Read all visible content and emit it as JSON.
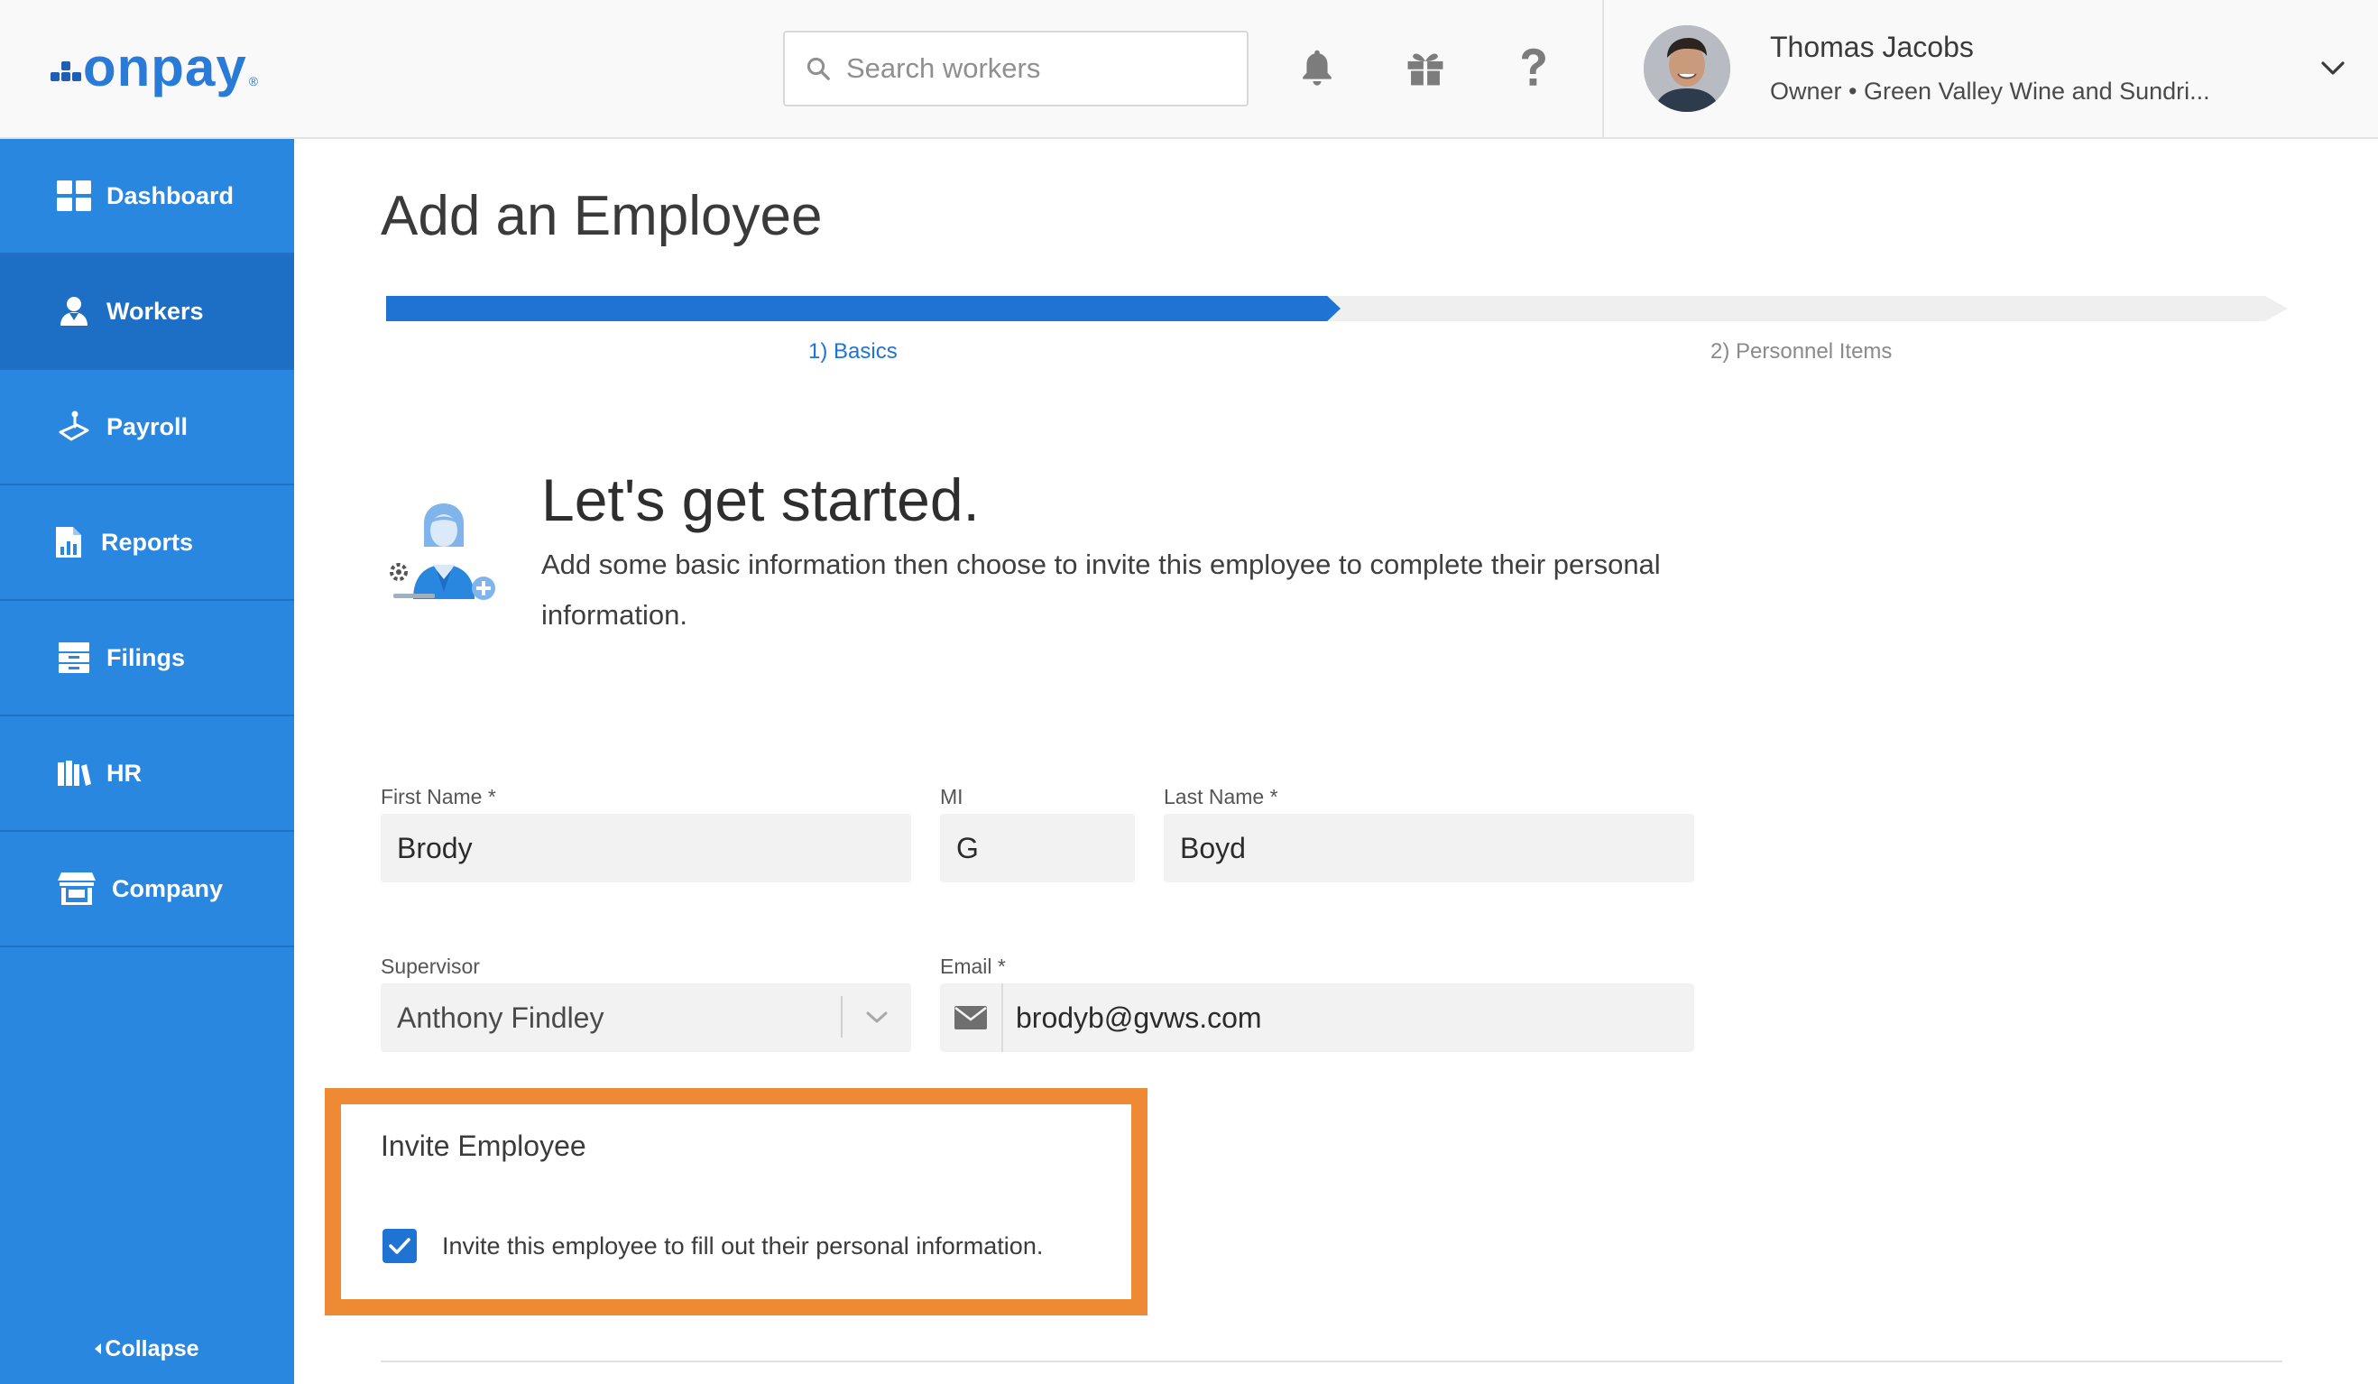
{
  "app": {
    "logo_text": "onpay",
    "logo_mark": "®"
  },
  "header": {
    "search_placeholder": "Search workers",
    "icons": [
      "bell-icon",
      "gift-icon",
      "help-icon"
    ],
    "user": {
      "name": "Thomas Jacobs",
      "role": "Owner • Green Valley Wine and Sundri..."
    }
  },
  "sidebar": {
    "items": [
      {
        "label": "Dashboard",
        "icon": "dashboard-icon",
        "active": false
      },
      {
        "label": "Workers",
        "icon": "workers-icon",
        "active": true
      },
      {
        "label": "Payroll",
        "icon": "payroll-icon",
        "active": false
      },
      {
        "label": "Reports",
        "icon": "reports-icon",
        "active": false
      },
      {
        "label": "Filings",
        "icon": "filings-icon",
        "active": false
      },
      {
        "label": "HR",
        "icon": "hr-icon",
        "active": false
      },
      {
        "label": "Company",
        "icon": "company-icon",
        "active": false
      }
    ],
    "collapse_label": "Collapse"
  },
  "main": {
    "title": "Add an Employee",
    "steps": [
      {
        "label": "1) Basics",
        "active": true
      },
      {
        "label": "2) Personnel Items",
        "active": false
      }
    ],
    "progress_fraction": 0.5,
    "intro": {
      "heading": "Let's get started.",
      "text": "Add some basic information then choose to invite this employee to complete their personal information."
    },
    "form": {
      "first_name": {
        "label": "First Name *",
        "value": "Brody"
      },
      "mi": {
        "label": "MI",
        "value": "G"
      },
      "last_name": {
        "label": "Last Name *",
        "value": "Boyd"
      },
      "supervisor": {
        "label": "Supervisor",
        "value": "Anthony Findley"
      },
      "email": {
        "label": "Email *",
        "value": "brodyb@gvws.com"
      }
    },
    "invite": {
      "title": "Invite Employee",
      "checkbox_label": "Invite this employee to fill out their personal information.",
      "checked": true
    }
  },
  "colors": {
    "brand_blue": "#2a87e0",
    "sidebar_active": "#1d6fc5",
    "progress_blue": "#1f73d3",
    "highlight_orange": "#ee8a34"
  }
}
